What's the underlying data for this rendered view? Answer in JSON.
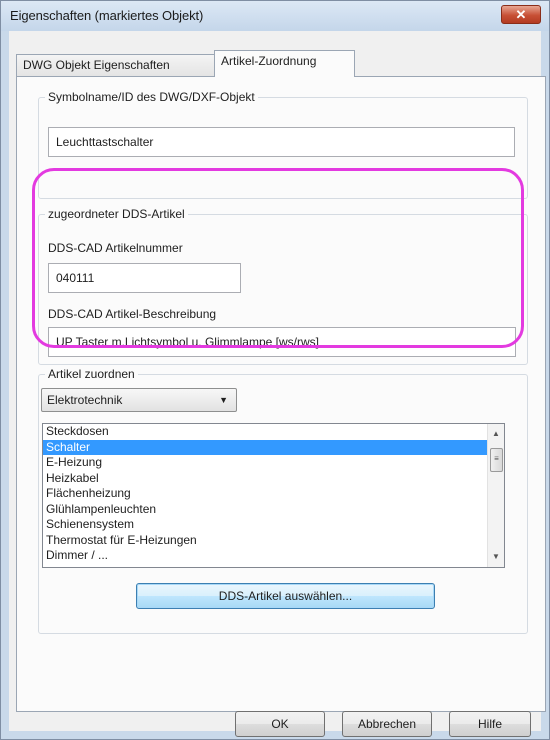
{
  "window": {
    "title": "Eigenschaften (markiertes Objekt)",
    "close_symbol": "✕"
  },
  "tabs": [
    {
      "label": "DWG Objekt Eigenschaften",
      "active": false
    },
    {
      "label": "Artikel-Zuordnung",
      "active": true
    }
  ],
  "symbol_group": {
    "legend": "Symbolname/ID des DWG/DXF-Objekt",
    "value": "Leuchttastschalter"
  },
  "dds_group": {
    "legend": "zugeordneter DDS-Artikel",
    "number_label": "DDS-CAD Artikelnummer",
    "number_value": "040111",
    "description_label": "DDS-CAD Artikel-Beschreibung",
    "description_value": "UP Taster m.Lichtsymbol u. Glimmlampe [ws/rws]"
  },
  "assign_group": {
    "legend": "Artikel zuordnen",
    "category_selected": "Elektrotechnik",
    "list_items": [
      "Steckdosen",
      "Schalter",
      "E-Heizung",
      "Heizkabel",
      "Flächenheizung",
      "Glühlampenleuchten",
      "Schienensystem",
      "Thermostat für E-Heizungen",
      "Dimmer / ..."
    ],
    "selected_item": "Schalter",
    "select_button": "DDS-Artikel auswählen..."
  },
  "buttons": {
    "ok": "OK",
    "cancel": "Abbrechen",
    "help": "Hilfe"
  },
  "colors": {
    "highlight": "#e33ae0",
    "selection": "#3399ff",
    "close_button": "#c75035"
  }
}
